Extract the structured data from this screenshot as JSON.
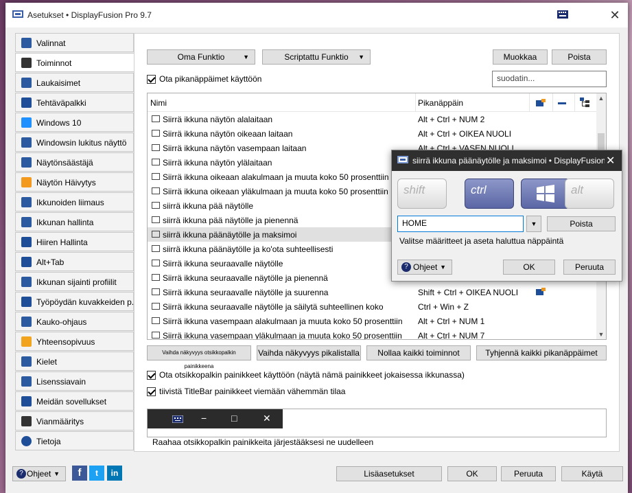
{
  "window": {
    "title": "Asetukset • DisplayFusion Pro 9.7",
    "close": "✕"
  },
  "sidebar": {
    "items": [
      {
        "label": "Valinnat",
        "icon": "settings-icon"
      },
      {
        "label": "Toiminnot",
        "icon": "sliders-icon"
      },
      {
        "label": "Laukaisimet",
        "icon": "trigger-icon"
      },
      {
        "label": "Tehtäväpalkki",
        "icon": "taskbar-icon"
      },
      {
        "label": "Windows 10",
        "icon": "windows-logo-icon"
      },
      {
        "label": "Windowsin lukitus näyttö",
        "icon": "lock-screen-icon"
      },
      {
        "label": "Näytönsäästäjä",
        "icon": "screensaver-icon"
      },
      {
        "label": "Näytön Häivytys",
        "icon": "monitor-fade-icon"
      },
      {
        "label": "Ikkunoiden liimaus",
        "icon": "window-snap-icon"
      },
      {
        "label": "Ikkunan hallinta",
        "icon": "window-management-icon"
      },
      {
        "label": "Hiiren Hallinta",
        "icon": "mouse-icon"
      },
      {
        "label": "Alt+Tab",
        "icon": "alt-tab-icon"
      },
      {
        "label": "Ikkunan sijainti profiilit",
        "icon": "window-position-icon"
      },
      {
        "label": "Työpöydän kuvakkeiden p...",
        "icon": "desktop-icons-icon"
      },
      {
        "label": "Kauko-ohjaus",
        "icon": "remote-control-icon"
      },
      {
        "label": "Yhteensopivuus",
        "icon": "compatibility-icon"
      },
      {
        "label": "Kielet",
        "icon": "language-icon"
      },
      {
        "label": "Lisenssiavain",
        "icon": "license-key-icon"
      },
      {
        "label": "Meidän sovellukset",
        "icon": "apps-icon"
      },
      {
        "label": "Vianmääritys",
        "icon": "troubleshoot-icon"
      },
      {
        "label": "Tietoja",
        "icon": "info-icon"
      }
    ]
  },
  "toolbar": {
    "custom_function": "Oma Funktio",
    "scripted_function": "Scriptattu Funktio",
    "edit": "Muokkaa",
    "delete": "Poista",
    "enable_hotkeys": "Ota pikanäppäimet käyttöön",
    "filter_placeholder": "suodatin..."
  },
  "grid": {
    "columns": [
      "Nimi",
      "Pikanäppäin"
    ],
    "column_icons": [
      "titlebar-button-icon",
      "minimize-icon",
      "tree-icon"
    ],
    "rows": [
      {
        "name": "Siirrä ikkuna näytön alalaitaan",
        "hotkey": "Alt + Ctrl + NUM 2"
      },
      {
        "name": "Siirrä ikkuna näytön oikeaan laitaan",
        "hotkey": "Alt + Ctrl + OIKEA NUOLI"
      },
      {
        "name": "Siirrä ikkuna näytön vasempaan laitaan",
        "hotkey": "Alt + Ctrl + VASEN NUOLI"
      },
      {
        "name": "Siirrä ikkuna näytön ylälaitaan",
        "hotkey": ""
      },
      {
        "name": "Siirrä ikkuna oikeaan alakulmaan ja muuta koko 50 prosenttiin",
        "hotkey": ""
      },
      {
        "name": "Siirrä ikkuna oikeaan yläkulmaan ja muuta koko 50 prosenttiin",
        "hotkey": ""
      },
      {
        "name": "siirrä ikkuna pää näytölle",
        "hotkey": ""
      },
      {
        "name": "siirrä ikkuna pää näytölle ja pienennä",
        "hotkey": ""
      },
      {
        "name": "siirrä ikkuna päänäytölle ja maksimoi",
        "hotkey": ""
      },
      {
        "name": "siirrä ikkuna päänäytölle ja ko'ota suhteellisesti",
        "hotkey": ""
      },
      {
        "name": "Siirrä ikkuna seuraavalle näytölle",
        "hotkey": ""
      },
      {
        "name": "Siirrä ikkuna seuraavalle näytölle ja pienennä",
        "hotkey": ""
      },
      {
        "name": "Siirrä ikkuna seuraavalle näytölle ja suurenna",
        "hotkey": "Shift + Ctrl + OIKEA NUOLI"
      },
      {
        "name": "Siirrä ikkuna seuraavalle näytölle ja säilytä suhteellinen koko",
        "hotkey": "Ctrl + Win + Z"
      },
      {
        "name": "Siirrä ikkuna vasempaan alakulmaan ja muuta koko 50 prosenttiin",
        "hotkey": "Alt + Ctrl + NUM 1"
      },
      {
        "name": "Siirrä ikkuna vasempaan yläkulmaan ja muuta koko 50 prosenttiin",
        "hotkey": "Alt + Ctrl + NUM 7"
      }
    ]
  },
  "actions": {
    "toggle_small": "Vaihda näkyvyys otsikkopalkin painikkeena",
    "toggle_quick": "Vaihda näkyvyys pikalistalla",
    "reset_all": "Nollaa kaikki toiminnot",
    "clear_hotkeys": "Tyhjennä kaikki pikanäppäimet"
  },
  "titlebar_options": {
    "enable_buttons": "Ota otsikkopalkin painikkeet käyttöön (näytä nämä painikkeet jokaisessa ikkunassa)",
    "compact": "tiivistä TitleBar painikkeet viemään vähemmän tilaa",
    "hint": "Raahaa otsikkopalkin painikkeita järjestääksesi ne uudelleen",
    "demo_min": "−",
    "demo_max": "□",
    "demo_close": "✕"
  },
  "popup": {
    "title": "siirrä ikkuna päänäytölle ja maksimoi • DisplayFusion",
    "close": "✕",
    "keys": {
      "shift": "shift",
      "ctrl": "ctrl",
      "alt": "alt"
    },
    "key_value": "HOME",
    "delete": "Poista",
    "instruction": "Valitse määritteet ja aseta haluttua näppäintä",
    "help": "Ohjeet",
    "ok": "OK",
    "cancel": "Peruuta"
  },
  "footer": {
    "help": "Ohjeet",
    "advanced": "Lisäasetukset",
    "ok": "OK",
    "cancel": "Peruuta",
    "apply": "Käytä",
    "social": [
      "f",
      "t",
      "in"
    ]
  },
  "colors": {
    "facebook": "#3b5998",
    "twitter": "#1da1f2",
    "linkedin": "#0077b5",
    "active_key": "#5b67a6"
  }
}
